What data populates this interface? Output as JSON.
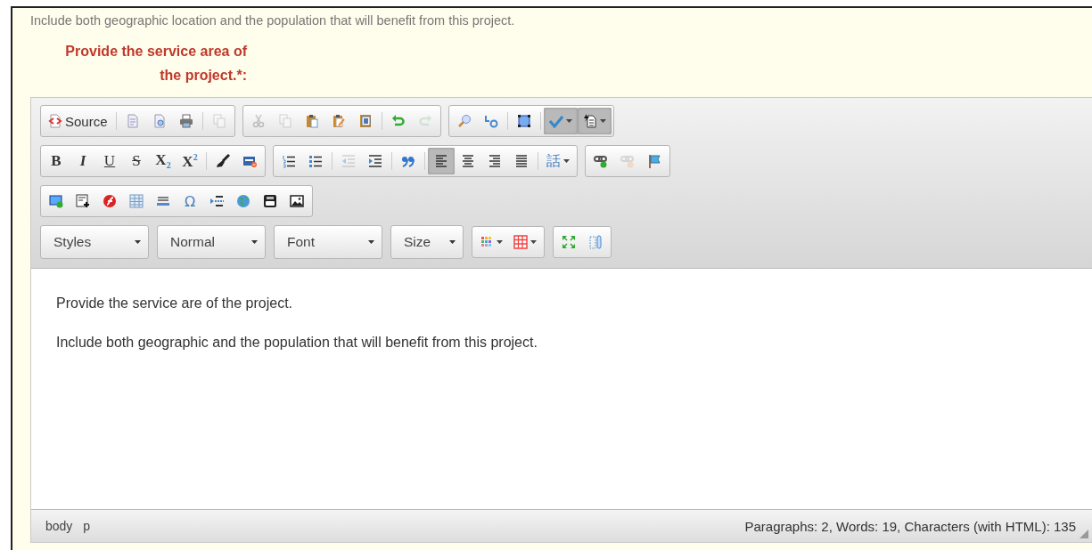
{
  "hint": "Include both geographic location and the population that will benefit from this project.",
  "field_label": "Provide the service area of the project.*:",
  "toolbar_rows": [
    [
      [
        {
          "kind": "icon",
          "label": "Source",
          "disabled": false,
          "on": false
        },
        {
          "kind": "separator"
        },
        {
          "kind": "icon",
          "disabled": false,
          "on": false
        },
        {
          "kind": "icon",
          "disabled": false,
          "on": false
        },
        {
          "kind": "icon",
          "disabled": false,
          "on": false
        },
        {
          "kind": "separator"
        },
        {
          "kind": "icon",
          "disabled": true,
          "on": false
        }
      ],
      [
        {
          "kind": "icon",
          "disabled": true,
          "on": false
        },
        {
          "kind": "icon",
          "disabled": true,
          "on": false
        },
        {
          "kind": "icon",
          "disabled": false,
          "on": false
        },
        {
          "kind": "icon",
          "disabled": false,
          "on": false
        },
        {
          "kind": "icon",
          "disabled": false,
          "on": false
        },
        {
          "kind": "separator"
        },
        {
          "kind": "icon",
          "disabled": false,
          "on": false
        },
        {
          "kind": "icon",
          "disabled": true,
          "on": false
        }
      ],
      [
        {
          "kind": "icon",
          "disabled": false,
          "on": false
        },
        {
          "kind": "icon",
          "disabled": false,
          "on": false
        },
        {
          "kind": "separator"
        },
        {
          "kind": "icon",
          "disabled": false,
          "on": false
        },
        {
          "kind": "separator"
        },
        {
          "kind": "icon",
          "dropdown": true,
          "disabled": false,
          "on": true
        },
        {
          "kind": "icon",
          "dropdown": true,
          "disabled": false,
          "on": true
        }
      ]
    ],
    [
      [
        {
          "kind": "glyph",
          "text": "B",
          "disabled": false,
          "on": false
        },
        {
          "kind": "glyph",
          "text": "I",
          "disabled": false,
          "on": false
        },
        {
          "kind": "glyph",
          "text": "U",
          "disabled": false,
          "on": false
        },
        {
          "kind": "glyph",
          "text": "S",
          "disabled": false,
          "on": false
        },
        {
          "kind": "glyph",
          "text": "X$_{2}$",
          "disabled": false,
          "on": false
        },
        {
          "kind": "glyph",
          "text": "X$^{2}$",
          "disabled": false,
          "on": false
        },
        {
          "kind": "separator"
        },
        {
          "kind": "icon",
          "disabled": false,
          "on": false
        },
        {
          "kind": "icon",
          "disabled": false,
          "on": false
        }
      ],
      [
        {
          "kind": "icon",
          "disabled": false,
          "on": false
        },
        {
          "kind": "icon",
          "disabled": false,
          "on": false
        },
        {
          "kind": "separator"
        },
        {
          "kind": "icon",
          "disabled": true,
          "on": false
        },
        {
          "kind": "icon",
          "disabled": false,
          "on": false
        },
        {
          "kind": "separator"
        },
        {
          "kind": "icon",
          "disabled": false,
          "on": false
        },
        {
          "kind": "separator"
        },
        {
          "kind": "icon",
          "disabled": false,
          "on": true
        },
        {
          "kind": "icon",
          "disabled": false,
          "on": false
        },
        {
          "kind": "icon",
          "disabled": false,
          "on": false
        },
        {
          "kind": "icon",
          "disabled": false,
          "on": false
        },
        {
          "kind": "separator"
        },
        {
          "kind": "glyph",
          "text": "話",
          "dropdown": true,
          "disabled": false,
          "on": false
        }
      ],
      [
        {
          "kind": "icon",
          "disabled": false,
          "on": false
        },
        {
          "kind": "icon",
          "disabled": true,
          "on": false
        },
        {
          "kind": "icon",
          "disabled": false,
          "on": false
        }
      ]
    ],
    [
      [
        {
          "kind": "icon",
          "disabled": false,
          "on": false
        },
        {
          "kind": "icon",
          "disabled": false,
          "on": false
        },
        {
          "kind": "icon",
          "disabled": false,
          "on": false
        },
        {
          "kind": "icon",
          "disabled": false,
          "on": false
        },
        {
          "kind": "icon",
          "disabled": false,
          "on": false
        },
        {
          "kind": "glyph",
          "text": "Ω",
          "disabled": false,
          "on": false
        },
        {
          "kind": "icon",
          "disabled": false,
          "on": false
        },
        {
          "kind": "icon",
          "disabled": false,
          "on": false
        },
        {
          "kind": "icon",
          "disabled": false,
          "on": false
        },
        {
          "kind": "icon",
          "disabled": false,
          "on": false
        }
      ]
    ],
    [
      [
        {
          "kind": "combo",
          "label": "Styles"
        }
      ],
      [
        {
          "kind": "combo",
          "label": "Normal"
        }
      ],
      [
        {
          "kind": "combo",
          "label": "Font"
        }
      ],
      [
        {
          "kind": "combo",
          "label": "Size"
        }
      ],
      [
        {
          "kind": "icon",
          "dropdown": true,
          "disabled": false,
          "on": false
        },
        {
          "kind": "icon",
          "dropdown": true,
          "disabled": false,
          "on": false
        }
      ],
      [
        {
          "kind": "icon",
          "disabled": false,
          "on": false
        },
        {
          "kind": "icon",
          "disabled": false,
          "on": false
        }
      ]
    ]
  ],
  "content": [
    "Provide the service are of the project.",
    "Include both geographic and the population that will benefit from this project."
  ],
  "elements_path": [
    "body",
    "p"
  ],
  "word_count": "Paragraphs: 2, Words: 19, Characters (with HTML): 135"
}
